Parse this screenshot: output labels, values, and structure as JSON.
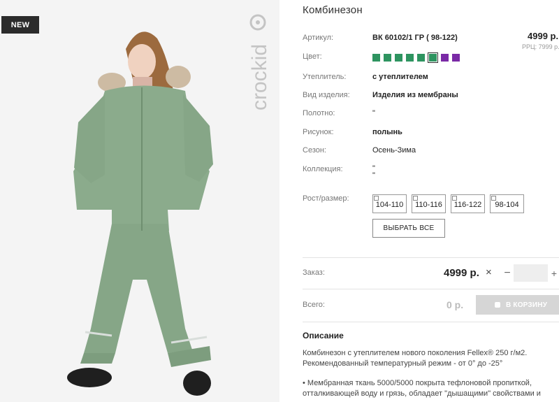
{
  "badge": "NEW",
  "brand": "crockid",
  "product": {
    "title": "Комбинезон",
    "price": "4999 р.",
    "rrp": "РРЦ: 7999 р.",
    "attributes": [
      {
        "label": "Артикул:",
        "value": "ВК 60102/1 ГР ( 98-122)",
        "bold": true
      },
      {
        "label": "Цвет:",
        "value": ""
      },
      {
        "label": "Утеплитель:",
        "value": "с утеплителем",
        "bold": true
      },
      {
        "label": "Вид изделия:",
        "value": "Изделия из мембраны",
        "bold": true
      },
      {
        "label": "Полотно:",
        "value": "\""
      },
      {
        "label": "Рисунок:",
        "value": "полынь",
        "bold": true
      },
      {
        "label": "Сезон:",
        "value": "Осень-Зима"
      },
      {
        "label": "Коллекция:",
        "value": "\"\n\""
      }
    ],
    "swatches": [
      {
        "color": "#2e9460",
        "selected": false
      },
      {
        "color": "#2e9460",
        "selected": false
      },
      {
        "color": "#2e9460",
        "selected": false
      },
      {
        "color": "#2e9460",
        "selected": false
      },
      {
        "color": "#2e9460",
        "selected": false
      },
      {
        "color": "#2e9460",
        "selected": true
      },
      {
        "color": "#7a2aa6",
        "selected": false
      },
      {
        "color": "#7a2aa6",
        "selected": false
      }
    ],
    "size_label": "Рост/размер:",
    "sizes": [
      "104-110",
      "110-116",
      "116-122",
      "98-104"
    ],
    "select_all": "ВЫБРАТЬ ВСЕ"
  },
  "order": {
    "label": "Заказ:",
    "price": "4999 р.",
    "times": "×",
    "minus": "−",
    "quantity": "",
    "plus": "+"
  },
  "total": {
    "label": "Всего:",
    "value": "0 р.",
    "cart_button": "В КОРЗИНУ"
  },
  "description": {
    "heading": "Описание",
    "lines": [
      "Комбинезон с утеплителем нового поколения Fellex® 250 г/м2.",
      "Рекомендованный температурный режим - от 0° до -25°",
      "",
      "• Мембранная ткань 5000/5000 покрыта тефлоновой пропиткой,",
      "отталкивающей воду и грязь, обладает \"дышащими\" свойствами и"
    ]
  },
  "colors": {
    "badge_bg": "#2b2b2b",
    "suit_green": "#8bab8c",
    "cart_disabled": "#d6d6d6"
  }
}
